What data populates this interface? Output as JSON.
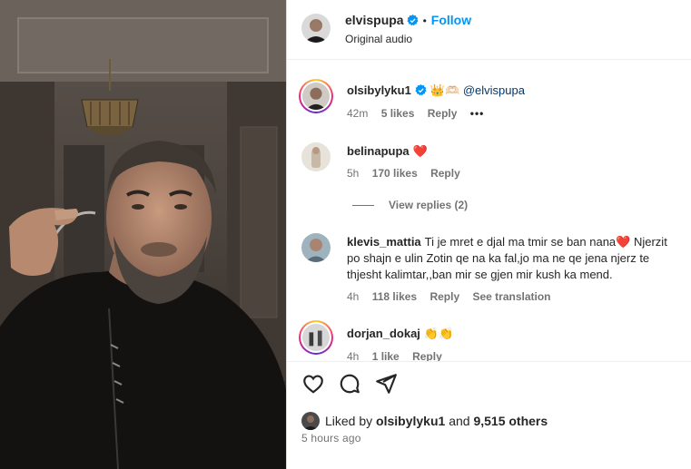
{
  "header": {
    "username": "elvispupa",
    "dot": "•",
    "follow_label": "Follow",
    "audio": "Original audio"
  },
  "comments": [
    {
      "username": "olsibylyku1",
      "verified": true,
      "text_emoji": "👑🫶🏻",
      "mention": "@elvispupa",
      "time": "42m",
      "likes": "5 likes",
      "reply": "Reply",
      "more": "•••"
    },
    {
      "username": "belinapupa",
      "text_emoji": "❤️",
      "time": "5h",
      "likes": "170 likes",
      "reply": "Reply",
      "view_replies": "View replies (2)"
    },
    {
      "username": "klevis_mattia",
      "text": "Ti je mret e djal ma tmir se ban nana❤️  Njerzit po shajn e ulin Zotin qe na ka fal,jo ma ne qe jena njerz te thjesht kalimtar,,ban mir se gjen mir kush ka mend.",
      "time": "4h",
      "likes": "118 likes",
      "reply": "Reply",
      "translate": "See translation"
    },
    {
      "username": "dorjan_dokaj",
      "text_emoji": "👏👏",
      "time": "4h",
      "likes": "1 like",
      "reply": "Reply"
    }
  ],
  "actions": {
    "icons": [
      "heart-icon",
      "comment-icon",
      "share-icon"
    ]
  },
  "likes_line": {
    "prefix": "Liked by",
    "user": "olsibylyku1",
    "and": "and",
    "others": "9,515 others"
  },
  "timestamp": "5 hours ago",
  "colors": {
    "accent": "#0095f6",
    "verified": "#0095f6",
    "meta": "#737373",
    "mention": "#00376b"
  }
}
